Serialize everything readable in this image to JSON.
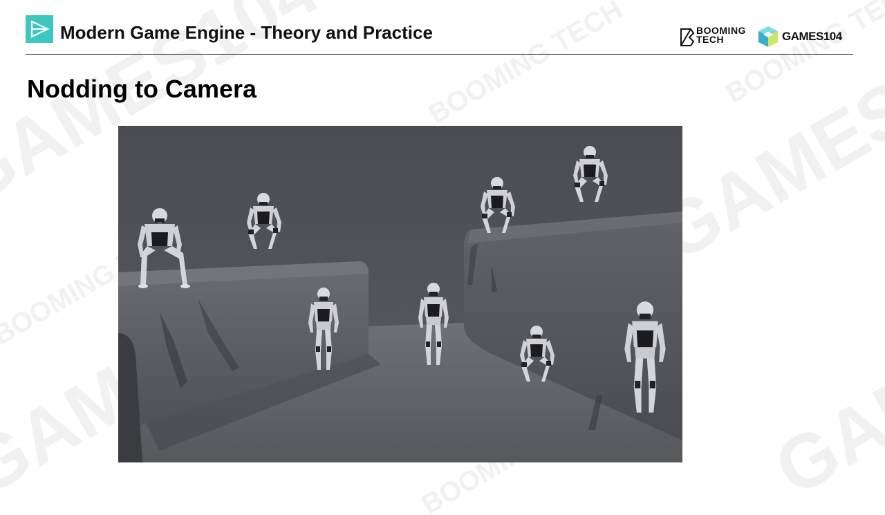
{
  "header": {
    "course_title": "Modern Game Engine - Theory and Practice",
    "logo_icon": "play-triangle-icon",
    "brand_booming_line1": "BOOMING",
    "brand_booming_line2": "TECH",
    "brand_games": "GAMES104",
    "accent_color": "#3ec7c1"
  },
  "slide": {
    "title": "Nodding to Camera"
  },
  "figure": {
    "description_icon": "robot-mannequins-scene"
  },
  "watermarks": {
    "text_games": "GAMES104",
    "text_booming": "BOOMING TECH"
  }
}
